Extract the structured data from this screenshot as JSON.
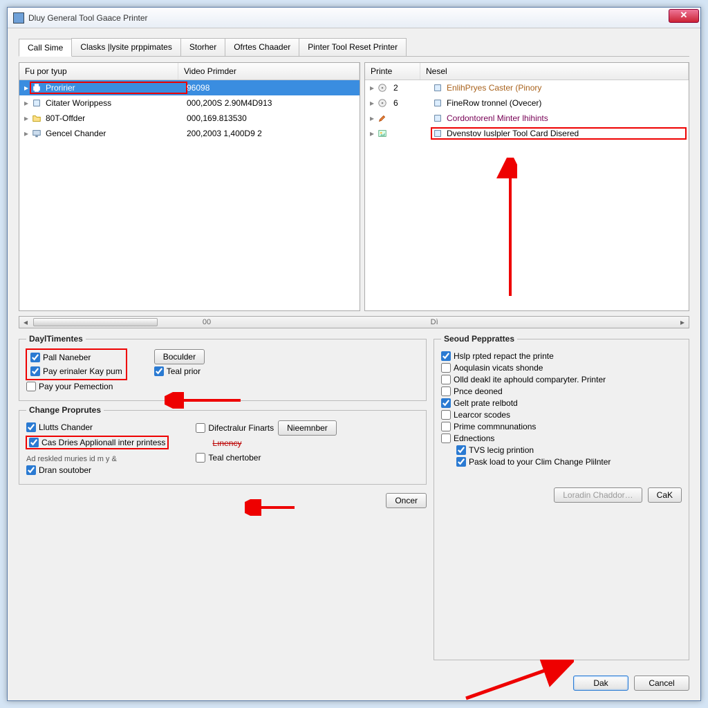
{
  "window": {
    "title": "Dluy General Tool Gaace Printer"
  },
  "tabs": [
    "Call Sime",
    "Clasks |lysite prppimates",
    "Storher",
    "Ofrtes Chaader",
    "Pinter Tool Reset Printer"
  ],
  "leftList": {
    "cols": [
      "Fu por tyup",
      "Video Primder"
    ],
    "rows": [
      {
        "name": "Proririer",
        "val": "96098",
        "selected": true,
        "icon": "printer",
        "hl": true
      },
      {
        "name": "Citater Worippess",
        "val": "000,200S 2.90M4D913",
        "selected": false,
        "icon": "device",
        "hl": false
      },
      {
        "name": "80T-Offder",
        "val": "000,169.813530",
        "selected": false,
        "icon": "folder",
        "hl": false
      },
      {
        "name": "Gencel Chander",
        "val": "200,2003 1,400D9 2",
        "selected": false,
        "icon": "monitor",
        "hl": false
      }
    ]
  },
  "rightList": {
    "cols": [
      "Printe",
      "Nesel"
    ],
    "rows": [
      {
        "num": "2",
        "name": "EnlihPryes Caster (Pinory",
        "cls": "muted",
        "hl": false
      },
      {
        "num": "6",
        "name": "FineRow tronnel (Ovecer)",
        "cls": "",
        "hl": false
      },
      {
        "num": "",
        "name": "Cordontorenl Minter lhihints",
        "cls": "muted2",
        "hl": false
      },
      {
        "num": "",
        "name": "Dvenstov Iuslpler Tool Card Disered",
        "cls": "",
        "hl": true
      }
    ]
  },
  "scroll": {
    "leftLabel": "00",
    "midLabel": "Dì"
  },
  "groupDay": {
    "legend": "DaylTimentes",
    "left": [
      {
        "label": "Pall Naneber",
        "checked": true
      },
      {
        "label": "Pay erinaler Kay pum",
        "checked": true
      },
      {
        "label": "Pay your Pemection",
        "checked": false
      }
    ],
    "rightBtn": "Boculder",
    "rightChk": {
      "label": "Teal prior",
      "checked": true
    }
  },
  "groupChange": {
    "legend": "Change Proprutes",
    "left": [
      {
        "label": "Llutts Chander",
        "checked": true,
        "hl": false
      },
      {
        "label": "Cas Dries Applionall inter printess",
        "checked": true,
        "hl": true
      }
    ],
    "mid": [
      {
        "type": "chk",
        "label": "Difectralur Finarts",
        "checked": false
      },
      {
        "type": "btn",
        "label": "Nieemnber"
      },
      {
        "type": "text",
        "label": "Lınency",
        "strike": true
      },
      {
        "type": "chk",
        "label": "Teal chertober",
        "checked": false
      }
    ],
    "sub": "Ad reskled muries id m y &",
    "left2": {
      "label": "Dran soutober",
      "checked": true
    }
  },
  "groupSeoud": {
    "legend": "Seoud Pepprattes",
    "items": [
      {
        "label": "Hslp rpted repact the printe",
        "checked": true
      },
      {
        "label": "Aoqulasin vicats shonde",
        "checked": false
      },
      {
        "label": "Olld deakl ite aphould comparyter. Printer",
        "checked": false
      },
      {
        "label": "Pnce deoned",
        "checked": false
      },
      {
        "label": "Gelt prate relbotd",
        "checked": true
      },
      {
        "label": "Learcor scodes",
        "checked": false
      },
      {
        "label": "Prime commnunations",
        "checked": false
      },
      {
        "label": "Ednections",
        "checked": false
      }
    ],
    "sub": [
      {
        "label": "TVS lecig printion",
        "checked": true
      },
      {
        "label": "Pask load to your Clim Change Plilnter",
        "checked": true
      }
    ]
  },
  "buttons": {
    "loradin": "Loradin Chaddor…",
    "cak": "CaK",
    "oncer": "Oncer",
    "dak": "Dak",
    "cancel": "Cancel"
  }
}
